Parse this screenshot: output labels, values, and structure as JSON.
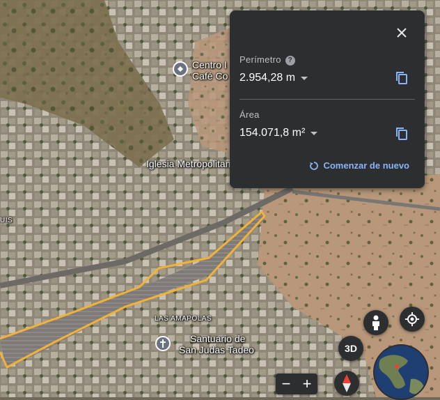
{
  "map": {
    "labels": {
      "centro": "Centro I",
      "cafe": "Café Co",
      "iglesia": "Iglesia Metropolitan",
      "amapolas": "LAS AMAPOLAS",
      "santuario_1": "Santuario de",
      "santuario_2": "San Judas Tadeo",
      "edge_left": "UIS"
    },
    "measure_polygon_color": "#f2b23a"
  },
  "measure_panel": {
    "perimeter_label": "Perímetro",
    "help_glyph": "?",
    "perimeter_value": "2.954,28 m",
    "area_label": "Área",
    "area_value": "154.071,8 m²",
    "restart_label": "Comenzar de nuevo",
    "accent": "#8ab4f8"
  },
  "controls": {
    "btn3d": "3D",
    "zoom_out": "−",
    "zoom_in": "+"
  }
}
